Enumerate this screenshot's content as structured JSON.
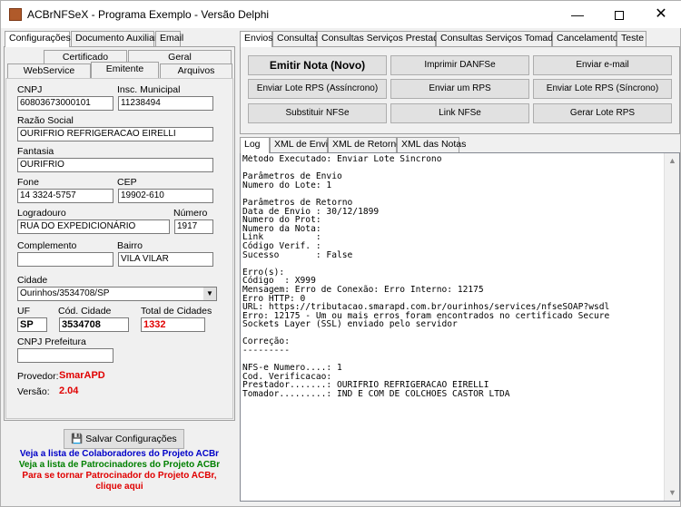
{
  "window": {
    "title": "ACBrNFSeX - Programa Exemplo - Versão Delphi"
  },
  "left_tabs": [
    "Configurações",
    "Documento Auxiliar",
    "Email"
  ],
  "config_tabs_row1": [
    "Certificado",
    "Geral"
  ],
  "config_tabs_row2": [
    "WebService",
    "Emitente",
    "Arquivos"
  ],
  "emitente": {
    "cnpj_label": "CNPJ",
    "cnpj": "60803673000101",
    "im_label": "Insc. Municipal",
    "im": "11238494",
    "razao_label": "Razão Social",
    "razao": "OURIFRIO REFRIGERACAO EIRELLI",
    "fantasia_label": "Fantasia",
    "fantasia": "OURIFRIO",
    "fone_label": "Fone",
    "fone": "14 3324-5757",
    "cep_label": "CEP",
    "cep": "19902-610",
    "logradouro_label": "Logradouro",
    "logradouro": "RUA DO EXPEDICIONÁRIO",
    "numero_label": "Número",
    "numero": "1917",
    "complemento_label": "Complemento",
    "complemento": "",
    "bairro_label": "Bairro",
    "bairro": "VILA VILAR",
    "cidade_label": "Cidade",
    "cidade": "Ourinhos/3534708/SP",
    "uf_label": "UF",
    "uf": "SP",
    "cod_cidade_label": "Cód. Cidade",
    "cod_cidade": "3534708",
    "total_label": "Total de Cidades",
    "total": "1332",
    "cnpj_pref_label": "CNPJ Prefeitura",
    "cnpj_pref": "",
    "provedor_label": "Provedor:",
    "provedor": "SmarAPD",
    "versao_label": "Versão:",
    "versao": "2.04"
  },
  "save_button": "Salvar Configurações",
  "links": {
    "colab": "Veja a lista de Colaboradores do Projeto ACBr",
    "patro": "Veja a lista de Patrocinadores do Projeto ACBr",
    "tornar1": "Para se tornar Patrocinador do Projeto ACBr,",
    "tornar2": "clique aqui"
  },
  "colors": {
    "link_blue": "#0000c8",
    "link_green": "#008000",
    "link_red": "#e00000",
    "value_red": "#e00000"
  },
  "right_tabs": [
    "Envios",
    "Consultas",
    "Consultas Serviços Prestados",
    "Consultas Serviços Tomados",
    "Cancelamento",
    "Teste"
  ],
  "buttons": [
    "Emitir Nota (Novo)",
    "Imprimir DANFSe",
    "Enviar e-mail",
    "Enviar Lote RPS (Assíncrono)",
    "Enviar um RPS",
    "Enviar Lote RPS (Síncrono)",
    "Substituir NFSe",
    "Link NFSe",
    "Gerar Lote RPS"
  ],
  "log_tabs": [
    "Log",
    "XML de Envio",
    "XML de Retorno",
    "XML das Notas"
  ],
  "log_lines": [
    "Método Executado: Enviar Lote Síncrono",
    "",
    "Parâmetros de Envio",
    "Numero do Lote: 1",
    "",
    "Parâmetros de Retorno",
    "Data de Envio : 30/12/1899",
    "Numero do Prot:",
    "Numero da Nota:",
    "Link          :",
    "Código Verif. :",
    "Sucesso       : False",
    "",
    "Erro(s):",
    "Código  : X999",
    "Mensagem: Erro de Conexão: Erro Interno: 12175",
    "Erro HTTP: 0",
    "URL: https://tributacao.smarapd.com.br/ourinhos/services/nfseSOAP?wsdl",
    "Erro: 12175 - Um ou mais erros foram encontrados no certificado Secure",
    "Sockets Layer (SSL) enviado pelo servidor",
    "",
    "Correção:",
    "---------",
    "",
    "NFS-e Numero....: 1",
    "Cod. Verificacao:",
    "Prestador.......: OURIFRIO REFRIGERACAO EIRELLI",
    "Tomador.........: IND E COM DE COLCHOES CASTOR LTDA"
  ]
}
